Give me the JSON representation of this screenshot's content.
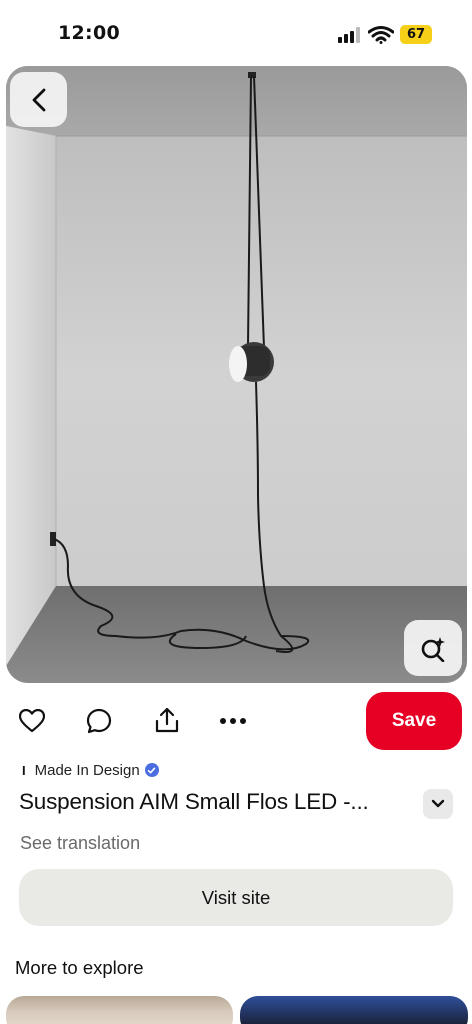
{
  "status_bar": {
    "time": "12:00",
    "battery": "67"
  },
  "pin": {
    "image_alt": "Black cylindrical pendant lamp hanging by its cable in an empty grey room",
    "source": {
      "name": "Made In Design",
      "logo_text": "I"
    },
    "title": "Suspension AIM Small Flos LED  -...",
    "see_translation": "See translation",
    "visit_label": "Visit site"
  },
  "actions": {
    "save_label": "Save"
  },
  "more": {
    "title": "More to explore"
  },
  "colors": {
    "save": "#e60023",
    "verified": "#4a6ee0",
    "battery": "#f5cf18"
  }
}
